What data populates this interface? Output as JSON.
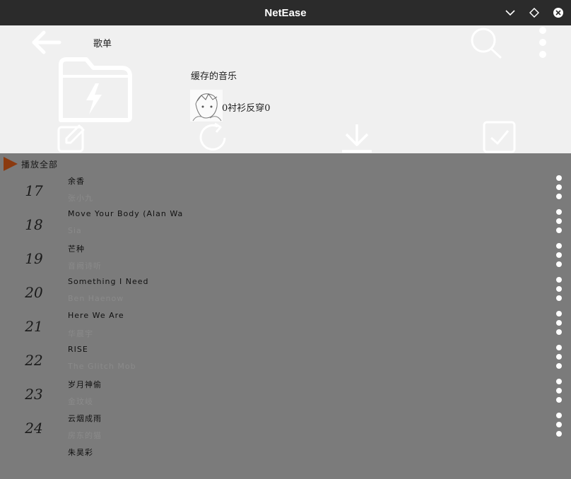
{
  "window": {
    "title": "NetEase"
  },
  "header": {
    "section_label": "歌单",
    "playlist_name": "缓存的音乐",
    "creator_name": "0衬衫反穿0"
  },
  "list": {
    "play_all_label": "播放全部",
    "songs": [
      {
        "index": "17",
        "title": "余香",
        "artist": "张小九"
      },
      {
        "index": "18",
        "title": "Move Your Body (Alan Wa",
        "artist": "Sia"
      },
      {
        "index": "19",
        "title": "芒种",
        "artist": "音阙诗听"
      },
      {
        "index": "20",
        "title": "Something I Need",
        "artist": "Ben Haenow"
      },
      {
        "index": "21",
        "title": "Here We Are",
        "artist": "华晨宇"
      },
      {
        "index": "22",
        "title": "RISE",
        "artist": "The Glitch Mob"
      },
      {
        "index": "23",
        "title": "岁月神偷",
        "artist": "金玟岐"
      },
      {
        "index": "24",
        "title": "云烟成雨",
        "artist": "房东的猫"
      },
      {
        "index": "",
        "title": "朱昊彩",
        "artist": ""
      }
    ]
  },
  "colors": {
    "titlebar": "#2b2b2b",
    "header_bg": "#f0f0f0",
    "list_bg": "#7b7b7b",
    "play_icon": "#8b3a0f"
  }
}
